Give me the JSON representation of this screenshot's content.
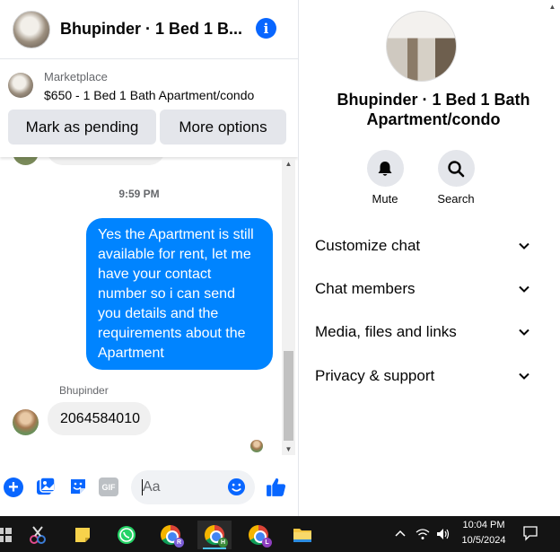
{
  "chat": {
    "title": "Bhupinder · 1 Bed 1 B...",
    "info_icon": "info-icon"
  },
  "marketplace": {
    "label": "Marketplace",
    "item": "$650 - 1 Bed 1 Bath Apartment/condo",
    "mark_pending": "Mark as pending",
    "more_options": "More options"
  },
  "messages": {
    "timestamp": "9:59 PM",
    "outgoing_text": "Yes the Apartment is still available for rent, let me have your contact number so i can send you details and the requirements about the Apartment",
    "sender_name": "Bhupinder",
    "incoming_text": "2064584010"
  },
  "composer": {
    "placeholder": "Aa"
  },
  "info_panel": {
    "name": "Bhupinder · 1 Bed 1 Bath Apartment/condo",
    "mute_label": "Mute",
    "search_label": "Search",
    "sections": [
      {
        "label": "Customize chat"
      },
      {
        "label": "Chat members"
      },
      {
        "label": "Media, files and links"
      },
      {
        "label": "Privacy & support"
      }
    ]
  },
  "taskbar": {
    "time": "10:04 PM",
    "date": "10/5/2024",
    "chrome_profiles": [
      "R",
      "H",
      "L"
    ]
  },
  "colors": {
    "accent": "#0866ff",
    "outgoing_bubble": "#0084ff",
    "incoming_bubble": "#f0f0f0"
  }
}
